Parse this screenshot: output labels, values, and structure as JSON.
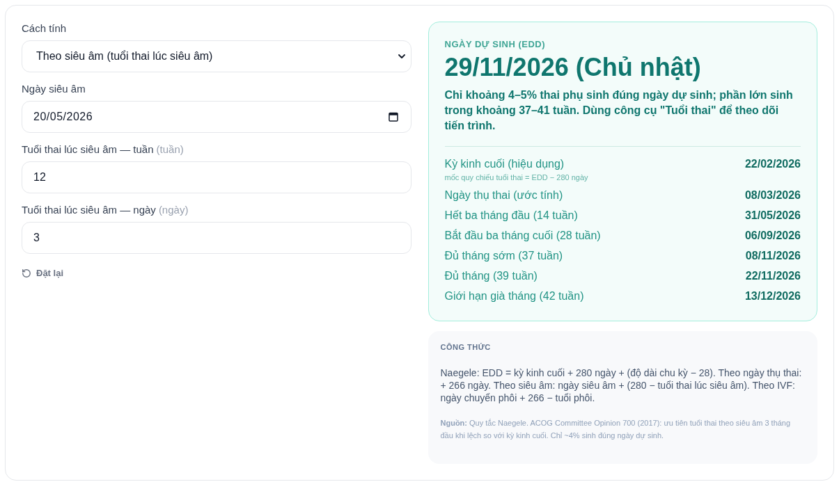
{
  "form": {
    "fields": [
      {
        "kind": "select",
        "label": "Cách tính",
        "value": "Theo siêu âm (tuổi thai lúc siêu âm)"
      },
      {
        "kind": "date",
        "label": "Ngày siêu âm",
        "value": "20/05/2026"
      },
      {
        "kind": "number",
        "label": "Tuổi thai lúc siêu âm — tuần",
        "unit": "(tuần)",
        "value": "12"
      },
      {
        "kind": "number",
        "label": "Tuổi thai lúc siêu âm — ngày",
        "unit": "(ngày)",
        "value": "3"
      }
    ],
    "reset_button": "Đặt lại"
  },
  "result": {
    "heading": "NGÀY DỰ SINH (EDD)",
    "date": "29/11/2026 (Chủ nhật)",
    "note": "Chỉ khoảng 4–5% thai phụ sinh đúng ngày dự sinh; phần lớn sinh trong khoảng 37–41 tuần. Dùng công cụ \"Tuổi thai\" để theo dõi tiến trình.",
    "milestones": [
      {
        "label": "Kỳ kinh cuối (hiệu dụng)",
        "hint": "mốc quy chiếu tuổi thai = EDD − 280 ngày",
        "value": "22/02/2026"
      },
      {
        "label": "Ngày thụ thai (ước tính)",
        "value": "08/03/2026"
      },
      {
        "label": "Hết ba tháng đầu (14 tuần)",
        "value": "31/05/2026"
      },
      {
        "label": "Bắt đầu ba tháng cuối (28 tuần)",
        "value": "06/09/2026"
      },
      {
        "label": "Đủ tháng sớm (37 tuần)",
        "value": "08/11/2026"
      },
      {
        "label": "Đủ tháng (39 tuần)",
        "value": "22/11/2026"
      },
      {
        "label": "Giới hạn già tháng (42 tuần)",
        "value": "13/12/2026"
      }
    ]
  },
  "formula": {
    "heading": "CÔNG THỨC",
    "text": "Naegele: EDD = kỳ kinh cuối + 280 ngày + (độ dài chu kỳ − 28). Theo ngày thụ thai: + 266 ngày. Theo siêu âm: ngày siêu âm + (280 − tuổi thai lúc siêu âm). Theo IVF: ngày chuyển phôi + 266 − tuổi phôi.",
    "source": "**Nguồn:** Quy tắc Naegele. ACOG Committee Opinion 700 (2017): ưu tiên tuổi thai theo siêu âm 3 tháng đầu khi lệch so với kỳ kinh cuối. Chỉ ~4% sinh đúng ngày dự sinh."
  }
}
